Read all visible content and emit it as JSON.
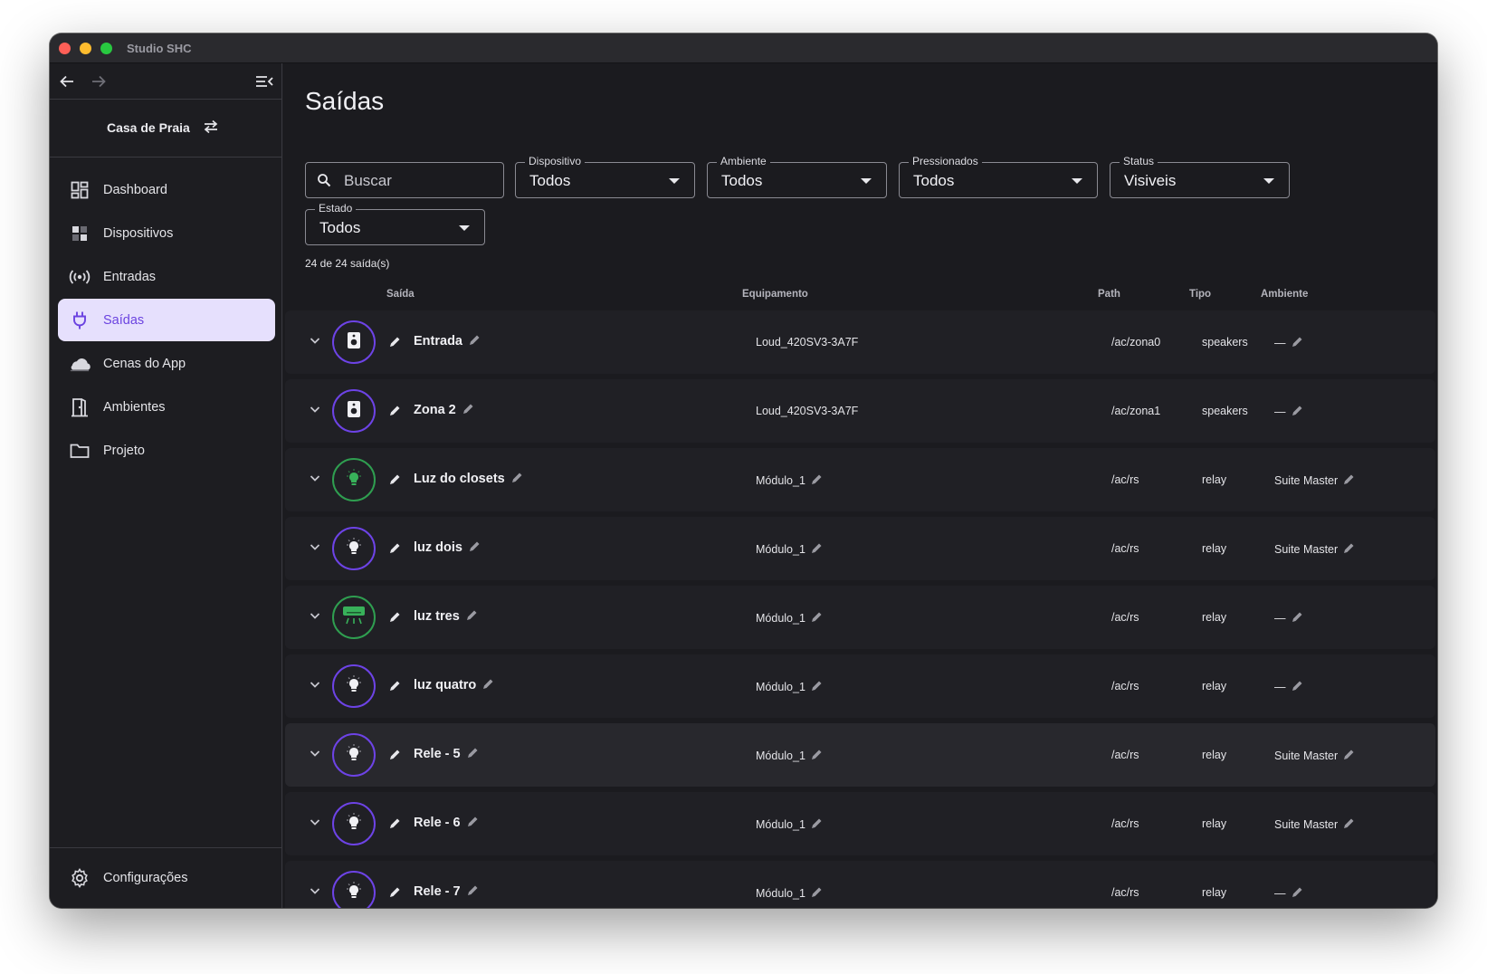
{
  "window": {
    "title": "Studio SHC"
  },
  "sidebar": {
    "project": "Casa de Praia",
    "items": [
      {
        "label": "Dashboard",
        "icon": "dashboard-icon",
        "active": false
      },
      {
        "label": "Dispositivos",
        "icon": "devices-icon",
        "active": false
      },
      {
        "label": "Entradas",
        "icon": "broadcast-icon",
        "active": false
      },
      {
        "label": "Saídas",
        "icon": "plug-icon",
        "active": true
      },
      {
        "label": "Cenas do App",
        "icon": "scene-icon",
        "active": false
      },
      {
        "label": "Ambientes",
        "icon": "door-icon",
        "active": false
      },
      {
        "label": "Projeto",
        "icon": "folder-icon",
        "active": false
      }
    ],
    "settings_label": "Configurações"
  },
  "main": {
    "title": "Saídas",
    "search": {
      "placeholder": "Buscar",
      "value": ""
    },
    "filters": [
      {
        "label": "Dispositivo",
        "value": "Todos"
      },
      {
        "label": "Ambiente",
        "value": "Todos"
      },
      {
        "label": "Pressionados",
        "value": "Todos"
      },
      {
        "label": "Status",
        "value": "Visiveis"
      },
      {
        "label": "Estado",
        "value": "Todos"
      }
    ],
    "count_text": "24 de 24 saída(s)",
    "columns": {
      "saida": "Saída",
      "equipamento": "Equipamento",
      "path": "Path",
      "tipo": "Tipo",
      "ambiente": "Ambiente"
    },
    "rows": [
      {
        "name": "Entrada",
        "icon": "speaker-icon",
        "ring": "purple",
        "equipment": "Loud_420SV3-3A7F",
        "equipment_editable": false,
        "path": "/ac/zona0",
        "type": "speakers",
        "room": "—"
      },
      {
        "name": "Zona 2",
        "icon": "speaker-icon",
        "ring": "purple",
        "equipment": "Loud_420SV3-3A7F",
        "equipment_editable": false,
        "path": "/ac/zona1",
        "type": "speakers",
        "room": "—"
      },
      {
        "name": "Luz do closets",
        "icon": "bulb-on-icon",
        "ring": "green",
        "equipment": "Módulo_1",
        "equipment_editable": true,
        "path": "/ac/rs",
        "type": "relay",
        "room": "Suite Master"
      },
      {
        "name": "luz dois",
        "icon": "bulb-icon",
        "ring": "purple",
        "equipment": "Módulo_1",
        "equipment_editable": true,
        "path": "/ac/rs",
        "type": "relay",
        "room": "Suite Master"
      },
      {
        "name": "luz tres",
        "icon": "air-conditioner-icon",
        "ring": "green",
        "equipment": "Módulo_1",
        "equipment_editable": true,
        "path": "/ac/rs",
        "type": "relay",
        "room": "—"
      },
      {
        "name": "luz quatro",
        "icon": "bulb-icon",
        "ring": "purple",
        "equipment": "Módulo_1",
        "equipment_editable": true,
        "path": "/ac/rs",
        "type": "relay",
        "room": "—"
      },
      {
        "name": "Rele - 5",
        "icon": "bulb-icon",
        "ring": "purple",
        "equipment": "Módulo_1",
        "equipment_editable": true,
        "path": "/ac/rs",
        "type": "relay",
        "room": "Suite Master"
      },
      {
        "name": "Rele - 6",
        "icon": "bulb-icon",
        "ring": "purple",
        "equipment": "Módulo_1",
        "equipment_editable": true,
        "path": "/ac/rs",
        "type": "relay",
        "room": "Suite Master"
      },
      {
        "name": "Rele - 7",
        "icon": "bulb-icon",
        "ring": "purple",
        "equipment": "Módulo_1",
        "equipment_editable": true,
        "path": "/ac/rs",
        "type": "relay",
        "room": "—"
      }
    ]
  },
  "colors": {
    "accent": "#6d43e6",
    "active_bg": "#e6e0fd",
    "on_green": "#2f9e50",
    "background": "#1b1b1f"
  }
}
